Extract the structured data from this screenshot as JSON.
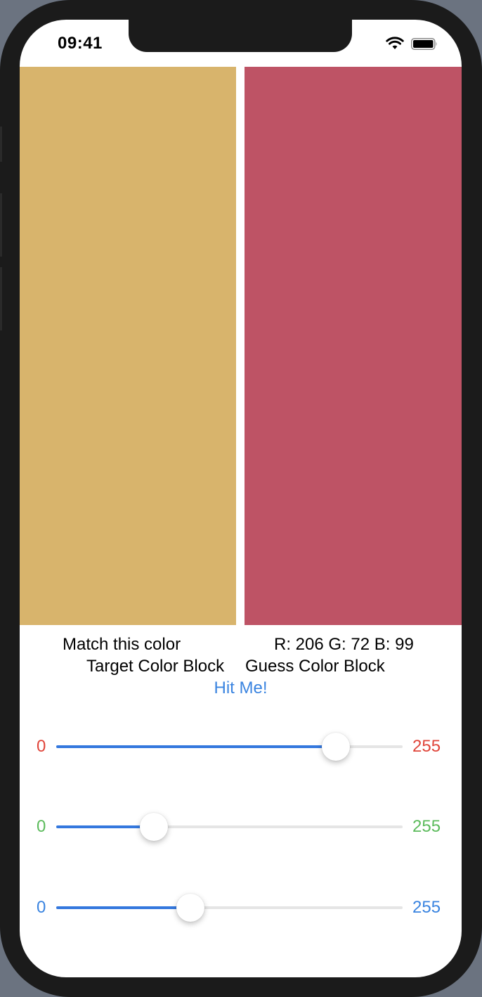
{
  "status_bar": {
    "time": "09:41"
  },
  "target_block": {
    "color": "#d8b46c"
  },
  "guess_block": {
    "color": "#be5365"
  },
  "labels": {
    "match": "Match this color",
    "rgb_readout": "R: 206  G: 72  B: 99",
    "target_caption": "Target Color Block",
    "guess_caption": "Guess Color Block"
  },
  "hit_button": {
    "label": "Hit Me!"
  },
  "sliders": [
    {
      "channel": "red",
      "min_label": "0",
      "max_label": "255",
      "value": 206,
      "max": 255,
      "label_color": "#e0453a"
    },
    {
      "channel": "green",
      "min_label": "0",
      "max_label": "255",
      "value": 72,
      "max": 255,
      "label_color": "#5cbb5c"
    },
    {
      "channel": "blue",
      "min_label": "0",
      "max_label": "255",
      "value": 99,
      "max": 255,
      "label_color": "#3a84e0"
    }
  ]
}
